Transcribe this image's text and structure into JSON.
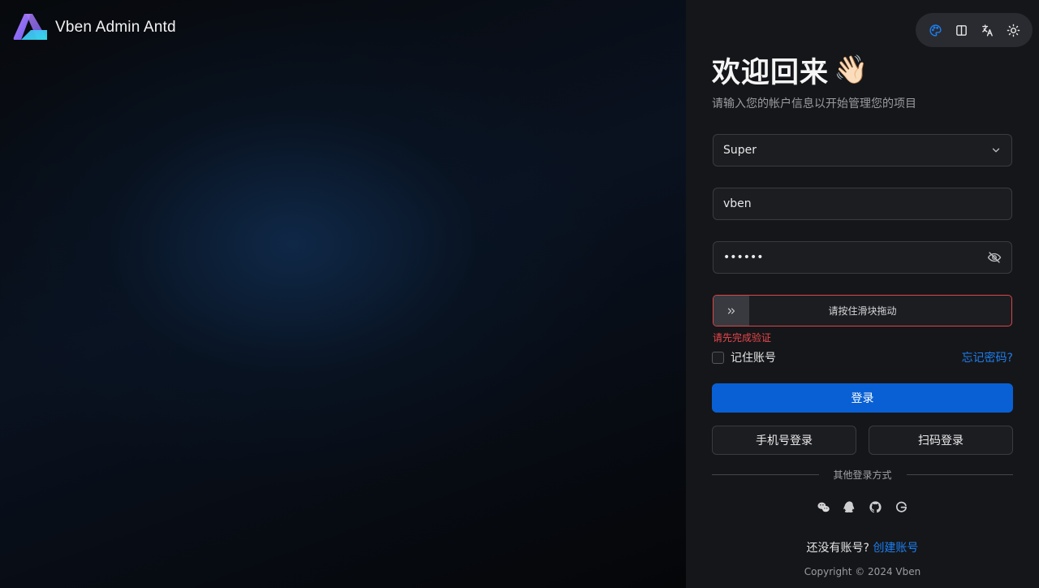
{
  "brand": {
    "name": "Vben Admin Antd"
  },
  "toolbar": {
    "items": [
      {
        "icon": "palette-icon",
        "color": "#1c7ef0"
      },
      {
        "icon": "layout-icon"
      },
      {
        "icon": "translate-icon"
      },
      {
        "icon": "sun-icon"
      }
    ]
  },
  "login": {
    "title": "欢迎回来",
    "wave_emoji": "👋🏻",
    "subtitle": "请输入您的帐户信息以开始管理您的项目",
    "account_select": {
      "value": "Super"
    },
    "username": {
      "value": "vben"
    },
    "password": {
      "value": "••••••"
    },
    "slider": {
      "text": "请按住滑块拖动"
    },
    "error": "请先完成验证",
    "remember_label": "记住账号",
    "forgot_label": "忘记密码?",
    "login_label": "登录",
    "phone_login_label": "手机号登录",
    "qrcode_login_label": "扫码登录",
    "other_methods_label": "其他登录方式",
    "social": [
      "wechat-icon",
      "qq-icon",
      "github-icon",
      "google-icon"
    ],
    "no_account_text": "还没有账号?",
    "create_account_label": "创建账号",
    "copyright": "Copyright © 2024 Vben"
  },
  "colors": {
    "primary": "#0960d4",
    "link": "#1c7ef0",
    "error": "#e8474b",
    "panel_bg": "#151619"
  }
}
